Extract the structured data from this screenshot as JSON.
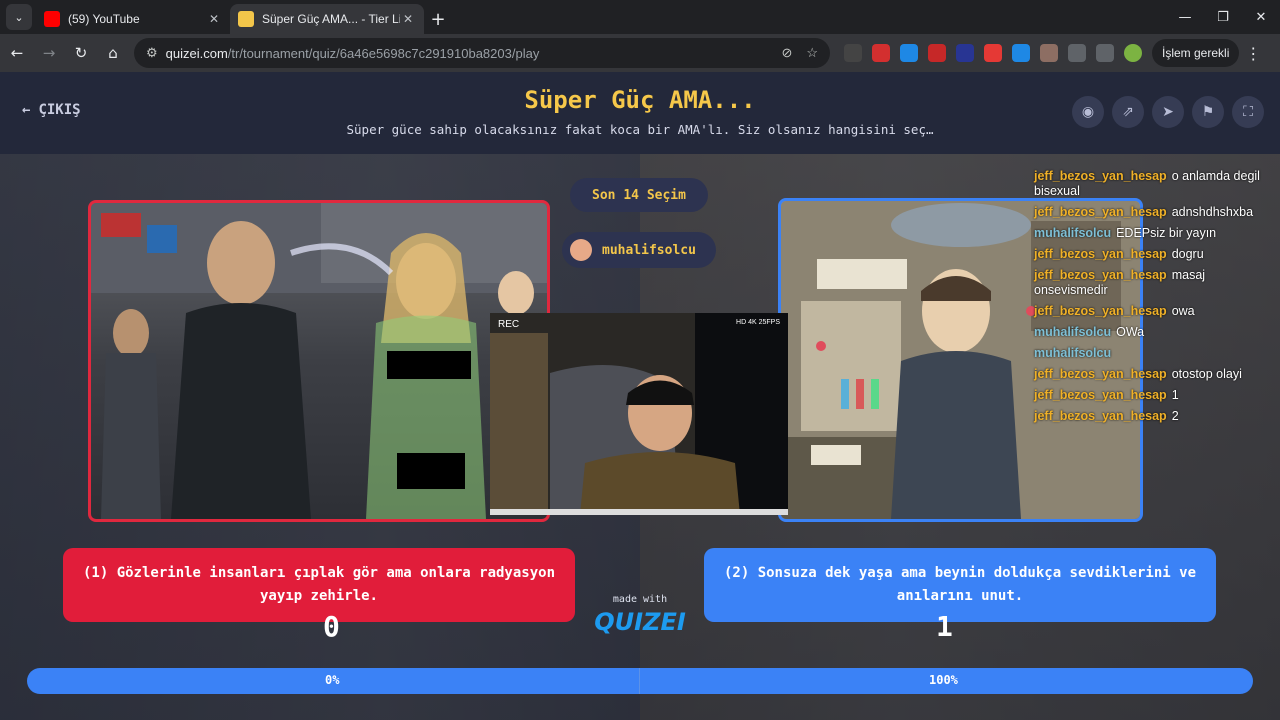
{
  "browser": {
    "tabs": [
      {
        "title": "(59) YouTube",
        "active": false
      },
      {
        "title": "Süper Güç AMA... - Tier List, Ko",
        "active": true
      }
    ],
    "address": {
      "host": "quizei.com",
      "path": "/tr/tournament/quiz/6a46e5698c7c291910ba8203/play"
    },
    "profile_label": "İşlem gerekli"
  },
  "page": {
    "exit_label": "ÇIKIŞ",
    "title": "Süper Güç AMA...",
    "subtitle": "Süper güce sahip olacaksınız fakat koca bir AMA'lı. Siz olsanız hangisini seç…",
    "header_icons": [
      "eye-icon",
      "share-icon",
      "send-icon",
      "flag-icon",
      "fullscreen-icon"
    ],
    "count_label": "Son 14 Seçim",
    "user_label": "muhalifsolcu",
    "made_with": "made with",
    "logo": "QUIZEI"
  },
  "webcam": {
    "rec": "REC",
    "hud": "HD 4K 25FPS"
  },
  "chat": [
    {
      "user": "jeff_bezos_yan_hesap",
      "msg": "o anlamda degil bisexual",
      "wrap": true,
      "color": "gold"
    },
    {
      "user": "jeff_bezos_yan_hesap",
      "msg": "adnshdhshxba",
      "color": "gold"
    },
    {
      "user": "muhalifsolcu",
      "msg": "EDEPsiz bir yayın",
      "color": "blue"
    },
    {
      "user": "jeff_bezos_yan_hesap",
      "msg": "dogru",
      "color": "gold"
    },
    {
      "user": "jeff_bezos_yan_hesap",
      "msg": "masaj onsevismedir",
      "wrap": true,
      "color": "gold"
    },
    {
      "user": "jeff_bezos_yan_hesap",
      "msg": "owa",
      "color": "gold"
    },
    {
      "user": "muhalifsolcu",
      "msg": "OWa",
      "color": "blue"
    },
    {
      "user": "muhalifsolcu",
      "msg": "",
      "color": "blue"
    },
    {
      "user": "jeff_bezos_yan_hesap",
      "msg": "otostop olayi",
      "color": "gold"
    },
    {
      "user": "jeff_bezos_yan_hesap",
      "msg": "1",
      "color": "gold"
    },
    {
      "user": "jeff_bezos_yan_hesap",
      "msg": "2",
      "color": "gold"
    }
  ],
  "choices": [
    {
      "label": "(1) Gözlerinle insanları çıplak gör ama onlara radyasyon yayıp zehirle.",
      "votes": "0",
      "percent": "0%",
      "color": "#e11d3a"
    },
    {
      "label": "(2) Sonsuza dek yaşa ama beynin doldukça sevdiklerini ve anılarını unut.",
      "votes": "1",
      "percent": "100%",
      "color": "#3b82f6"
    }
  ],
  "result": {
    "left_share": 0,
    "right_share": 1
  }
}
